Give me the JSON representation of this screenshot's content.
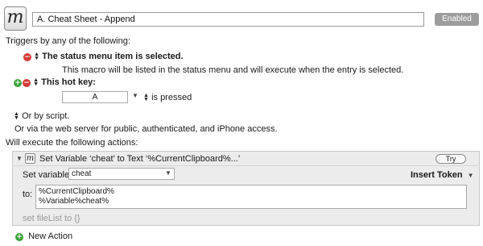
{
  "macro": {
    "icon_glyph": "m",
    "name": "A. Cheat Sheet - Append",
    "enabled_label": "Enabled"
  },
  "triggers": {
    "heading": "Triggers by any of the following:",
    "status_menu": {
      "label": "The status menu item is selected.",
      "description": "This macro will be listed in the status menu and will execute when the entry is selected."
    },
    "hot_key": {
      "label": "This hot key:",
      "key": "A",
      "condition": "is pressed"
    },
    "or_script": "Or by script.",
    "web_server": "Or via the web server for public, authenticated, and iPhone access."
  },
  "actions": {
    "heading": "Will execute the following actions:",
    "items": [
      {
        "title": "Set Variable ‘cheat’ to Text ‘%CurrentClipboard%...’",
        "try_label": "Try",
        "set_variable_label": "Set variable",
        "variable_name": "cheat",
        "insert_token_label": "Insert Token",
        "to_label": "to:",
        "to_lines": [
          "%CurrentClipboard%",
          "%Variable%cheat%"
        ],
        "next_preview": "set fileList to {}"
      }
    ],
    "new_action_label": "New Action"
  }
}
